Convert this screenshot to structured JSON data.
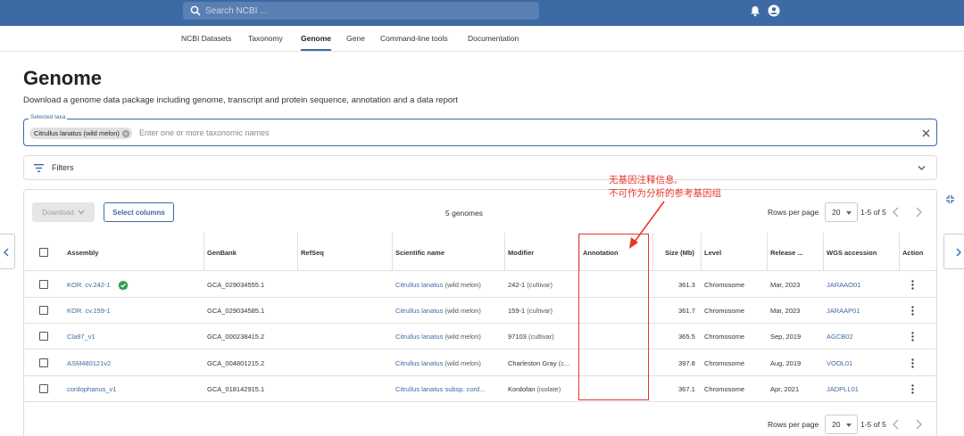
{
  "header": {
    "search_placeholder": "Search NCBI ...",
    "icons": [
      "search-icon",
      "bell-icon",
      "account-icon"
    ]
  },
  "tabs": [
    {
      "label": "NCBI Datasets",
      "active": false
    },
    {
      "label": "Taxonomy",
      "active": false
    },
    {
      "label": "Genome",
      "active": true
    },
    {
      "label": "Gene",
      "active": false
    },
    {
      "label": "Command-line tools",
      "active": false
    },
    {
      "label": "Documentation",
      "active": false
    }
  ],
  "page": {
    "title": "Genome",
    "description": "Download a genome data package including genome, transcript and protein sequence, annotation and a data report"
  },
  "taxa": {
    "legend": "Selected taxa",
    "chip": "Citrullus lanatus (wild melon)",
    "placeholder": "Enter one or more taxonomic names"
  },
  "filters": {
    "label": "Filters"
  },
  "toolbar": {
    "download_label": "Download",
    "select_columns_label": "Select columns",
    "count": "5 genomes"
  },
  "pagination": {
    "rows_per_page_label": "Rows per page",
    "rows_per_page": "20",
    "range": "1-5 of 5"
  },
  "table": {
    "columns": [
      "Assembly",
      "GenBank",
      "RefSeq",
      "Scientific name",
      "Modifier",
      "Annotation",
      "Size (Mb)",
      "Level",
      "Release ...",
      "WGS accession",
      "Action"
    ],
    "rows": [
      {
        "assembly": "KOR. cv.242-1",
        "verified": true,
        "genbank": "GCA_029034555.1",
        "refseq": "",
        "sci_main": "Citrullus lanatus",
        "sci_extra": " (wild melon)",
        "modifier": "242-1",
        "modifier_extra": " (cultivar)",
        "annotation": "",
        "size": "361.3",
        "level": "Chromosome",
        "release": "Mar, 2023",
        "wgs": "JARAAO01"
      },
      {
        "assembly": "KOR. cv.159-1",
        "verified": false,
        "genbank": "GCA_029034585.1",
        "refseq": "",
        "sci_main": "Citrullus lanatus",
        "sci_extra": " (wild melon)",
        "modifier": "159-1",
        "modifier_extra": " (cultivar)",
        "annotation": "",
        "size": "361.7",
        "level": "Chromosome",
        "release": "Mar, 2023",
        "wgs": "JARAAP01"
      },
      {
        "assembly": "Cla97_v1",
        "verified": false,
        "genbank": "GCA_000238415.2",
        "refseq": "",
        "sci_main": "Citrullus lanatus",
        "sci_extra": " (wild melon)",
        "modifier": "97103",
        "modifier_extra": " (cultivar)",
        "annotation": "",
        "size": "365.5",
        "level": "Chromosome",
        "release": "Sep, 2019",
        "wgs": "AGCB02"
      },
      {
        "assembly": "ASM480121v2",
        "verified": false,
        "genbank": "GCA_004801215.2",
        "refseq": "",
        "sci_main": "Citrullus lanatus",
        "sci_extra": " (wild melon)",
        "modifier": "Charleston Gray",
        "modifier_extra": " (c...",
        "annotation": "",
        "size": "397.8",
        "level": "Chromosome",
        "release": "Aug, 2019",
        "wgs": "VOOL01"
      },
      {
        "assembly": "cordophanus_v1",
        "verified": false,
        "genbank": "GCA_018142915.1",
        "refseq": "",
        "sci_main": "Citrullus lanatus subsp. cord...",
        "sci_extra": "",
        "modifier": "Kordofan",
        "modifier_extra": " (isolate)",
        "annotation": "",
        "size": "367.1",
        "level": "Chromosome",
        "release": "Apr, 2021",
        "wgs": "JADPLL01"
      }
    ]
  },
  "annotation_note": {
    "line1": "无基因注释信息,",
    "line2": "不可作为分析的参考基因组",
    "color": "#e8372a"
  },
  "colors": {
    "brand": "#3d6aa5",
    "annotation": "#e8372a",
    "verified": "#2e9e4f"
  }
}
